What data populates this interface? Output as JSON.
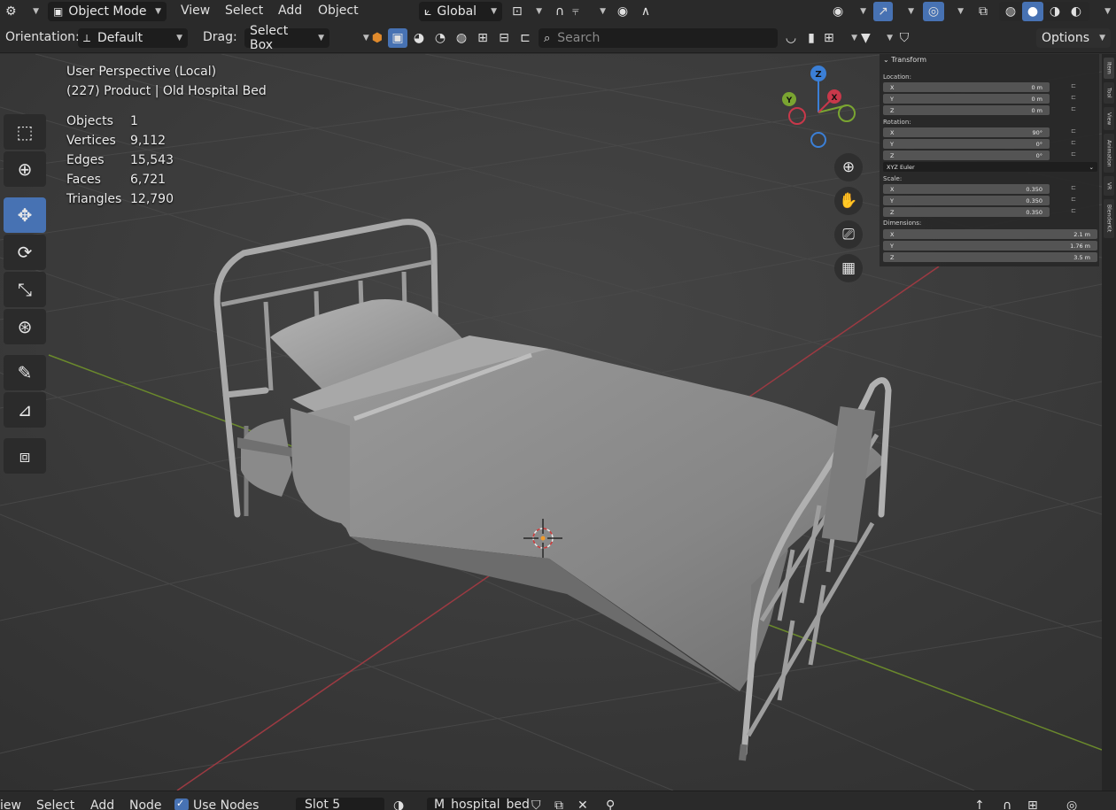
{
  "header": {
    "mode": "Object Mode",
    "menus": [
      "View",
      "Select",
      "Add",
      "Object"
    ],
    "transform_orientation": "Global"
  },
  "toolheader": {
    "orientation_label": "Orientation:",
    "orientation_value": "Default",
    "drag_label": "Drag:",
    "drag_value": "Select Box",
    "search_placeholder": "Search",
    "options_label": "Options"
  },
  "viewport": {
    "perspective": "User Perspective (Local)",
    "collection": "(227) Product | Old Hospital Bed",
    "stats": [
      {
        "label": "Objects",
        "value": "1"
      },
      {
        "label": "Vertices",
        "value": "9,112"
      },
      {
        "label": "Edges",
        "value": "15,543"
      },
      {
        "label": "Faces",
        "value": "6,721"
      },
      {
        "label": "Triangles",
        "value": "12,790"
      }
    ],
    "gizmo_axes": {
      "x": "X",
      "y": "Y",
      "z": "Z"
    }
  },
  "npanel": {
    "title": "Transform",
    "location_label": "Location:",
    "location": [
      {
        "axis": "X",
        "value": "0 m"
      },
      {
        "axis": "Y",
        "value": "0 m"
      },
      {
        "axis": "Z",
        "value": "0 m"
      }
    ],
    "rotation_label": "Rotation:",
    "rotation": [
      {
        "axis": "X",
        "value": "90°"
      },
      {
        "axis": "Y",
        "value": "0°"
      },
      {
        "axis": "Z",
        "value": "0°"
      }
    ],
    "rotation_mode": "XYZ Euler",
    "scale_label": "Scale:",
    "scale": [
      {
        "axis": "X",
        "value": "0.350"
      },
      {
        "axis": "Y",
        "value": "0.350"
      },
      {
        "axis": "Z",
        "value": "0.350"
      }
    ],
    "dimensions_label": "Dimensions:",
    "dimensions": [
      {
        "axis": "X",
        "value": "2.1 m"
      },
      {
        "axis": "Y",
        "value": "1.76 m"
      },
      {
        "axis": "Z",
        "value": "3.5 m"
      }
    ],
    "tabs": [
      "Item",
      "Tool",
      "View",
      "Animation",
      "VR",
      "BlenderKit"
    ]
  },
  "bottom": {
    "menus": [
      "iew",
      "Select",
      "Add",
      "Node"
    ],
    "use_nodes_label": "Use Nodes",
    "slot": "Slot 5",
    "material": "M_hospital_bed"
  },
  "colors": {
    "accent": "#4772b3",
    "axis_x": "#c8384a",
    "axis_y": "#7aa531",
    "axis_z": "#3b7fd6"
  }
}
